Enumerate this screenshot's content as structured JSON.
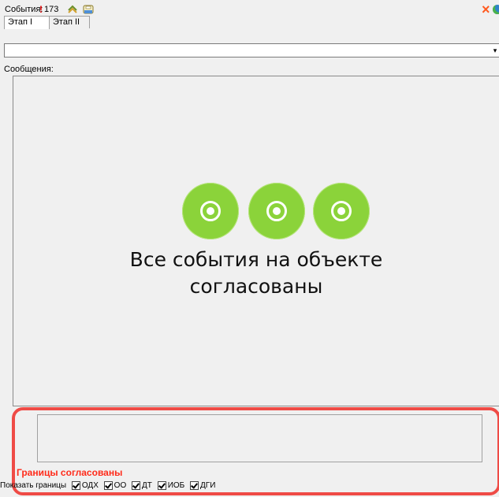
{
  "header": {
    "events_label": "События:",
    "alert_mark": "!",
    "events_count": "173",
    "tabs": [
      {
        "label": "Этап I"
      },
      {
        "label": "Этап II"
      }
    ],
    "close_glyph": "×"
  },
  "messages": {
    "label": "Сообщения:",
    "empty_line1": "Все события на объекте",
    "empty_line2": "согласованы"
  },
  "bottom": {
    "status": "Границы согласованы",
    "show_borders_label": "Показать границы",
    "checkboxes": [
      {
        "label": "ОДХ",
        "checked": true
      },
      {
        "label": "ОО",
        "checked": true
      },
      {
        "label": "ДТ",
        "checked": true
      },
      {
        "label": "ИОБ",
        "checked": true
      },
      {
        "label": "ДГИ",
        "checked": true
      }
    ]
  },
  "colors": {
    "accent_green": "#8bd33a",
    "alert_red": "#ff2b1a",
    "frame_red": "#ef4b46"
  }
}
